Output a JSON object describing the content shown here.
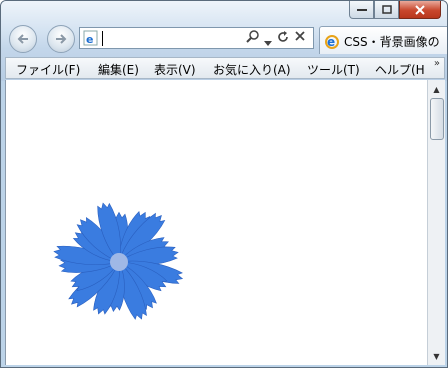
{
  "window": {
    "caption_buttons": [
      "minimize",
      "maximize",
      "close"
    ]
  },
  "nav": {
    "back_icon": "back-arrow-icon",
    "forward_icon": "forward-arrow-icon"
  },
  "address": {
    "value": "",
    "page_icon": "ie-page-icon",
    "search_icon": "search-icon",
    "dropdown_icon": "chevron-down-icon",
    "refresh_icon": "refresh-icon",
    "stop_icon": "stop-icon"
  },
  "tab": {
    "title": "CSS・背景画像の",
    "icon": "ie-page-icon"
  },
  "menu": {
    "items": [
      "ファイル(F)",
      "編集(E)",
      "表示(V)",
      "お気に入り(A)",
      "ツール(T)",
      "ヘルプ(H"
    ],
    "more_label": "»"
  },
  "content": {
    "image": "blue-chicory-flower",
    "flower_color": "#3a7ce0"
  },
  "colors": {
    "frame": "#c3d6ea",
    "close_button": "#c8472d"
  }
}
